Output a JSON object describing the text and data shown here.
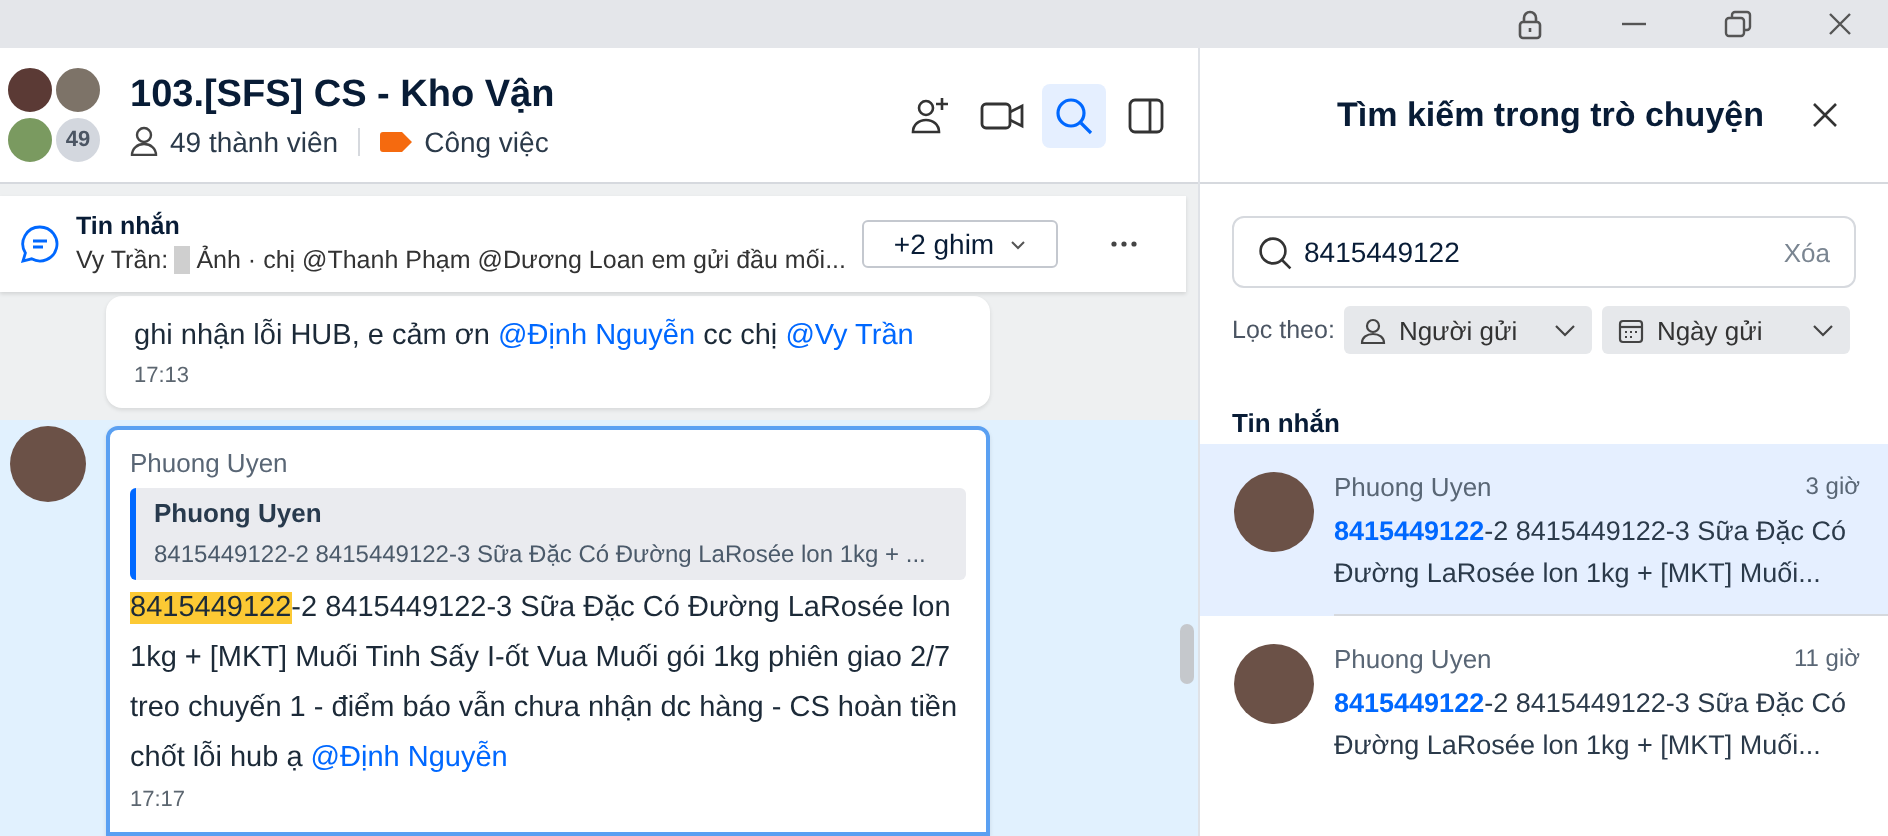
{
  "conversation": {
    "title": "103.[SFS] CS - Kho Vận",
    "member_badge": "49",
    "members": "49 thành viên",
    "tag": {
      "label": "Công việc",
      "color": "#f56a0f"
    }
  },
  "toolbar": [
    {
      "kind": "add-member",
      "selected": false
    },
    {
      "kind": "video",
      "selected": false
    },
    {
      "kind": "search",
      "selected": true
    },
    {
      "kind": "sidebar",
      "selected": false
    }
  ],
  "pinned": {
    "title": "Tin nhắn",
    "sender": "Vy Trần:",
    "preview": "Ảnh · chị @Thanh Phạm @Dương Loan em gửi đầu mối...",
    "more_pins": "+2 ghim"
  },
  "messages": [
    {
      "selected": false,
      "parts": [
        {
          "kind": "text",
          "text": "ghi nhận lỗi HUB, e cảm ơn "
        },
        {
          "kind": "mention",
          "text": "@Định Nguyễn"
        },
        {
          "kind": "text",
          "text": "  cc chị "
        },
        {
          "kind": "mention",
          "text": "@Vy Trần"
        }
      ],
      "time": "17:13"
    },
    {
      "selected": true,
      "sender": "Phuong Uyen",
      "quote": {
        "sender": "Phuong Uyen",
        "text": "8415449122-2 8415449122-3 Sữa Đặc Có Đường LaRosée lon 1kg + ..."
      },
      "parts": [
        {
          "kind": "highlight",
          "text": "8415449122"
        },
        {
          "kind": "text",
          "text": "-2 8415449122-3 Sữa Đặc Có Đường LaRosée lon 1kg + [MKT] Muối Tinh Sấy I-ốt Vua Muối gói 1kg phiên giao 2/7 treo chuyến 1 - điểm báo vẫn chưa nhận dc hàng - CS hoàn tiền chốt lỗi hub ạ "
        },
        {
          "kind": "mention",
          "text": "@Định Nguyễn"
        }
      ],
      "time": "17:17"
    }
  ],
  "search": {
    "title": "Tìm kiếm trong trò chuyện",
    "query": "8415449122",
    "clear": "Xóa",
    "filter_label": "Lọc theo:",
    "filters": [
      {
        "kind": "sender",
        "label": "Người gửi"
      },
      {
        "kind": "date",
        "label": "Ngày gửi"
      }
    ],
    "section": "Tin nhắn",
    "results": [
      {
        "sender": "Phuong Uyen",
        "time": "3 giờ",
        "match": "8415449122",
        "text": "-2 8415449122-3 Sữa Đặc Có Đường LaRosée lon 1kg + [MKT] Muối...",
        "selected": true
      },
      {
        "sender": "Phuong Uyen",
        "time": "11 giờ",
        "match": "8415449122",
        "text": "-2 8415449122-3 Sữa Đặc Có Đường LaRosée lon 1kg + [MKT] Muối...",
        "selected": false
      }
    ]
  }
}
